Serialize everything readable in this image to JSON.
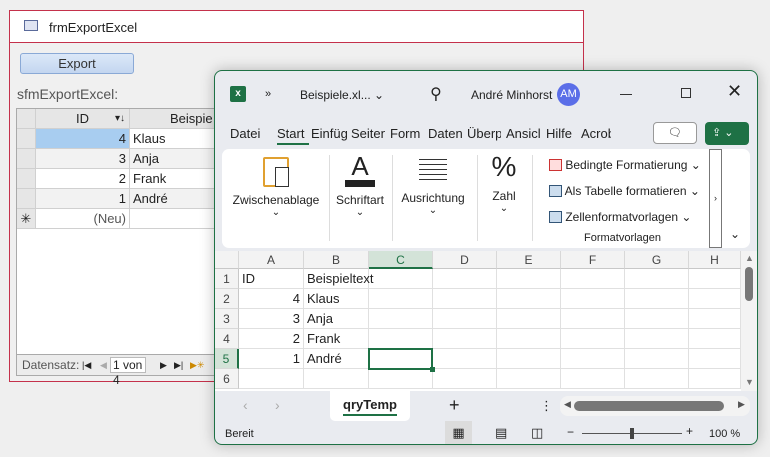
{
  "access": {
    "title": "frmExportExcel",
    "export_label": "Export",
    "subform_label": "sfmExportExcel:",
    "columns": [
      "ID",
      "Beispie"
    ],
    "rows": [
      {
        "id": "4",
        "text": "Klaus"
      },
      {
        "id": "3",
        "text": "Anja"
      },
      {
        "id": "2",
        "text": "Frank"
      },
      {
        "id": "1",
        "text": "André"
      }
    ],
    "new_row": "(Neu)",
    "nav_label": "Datensatz:",
    "nav_position": "1 von 4"
  },
  "excel": {
    "filename": "Beispiele.xl...",
    "user": "André Minhorst",
    "avatar": "AM",
    "accent": "#1e7145",
    "tabs": [
      "Datei",
      "Start",
      "Einfüg",
      "Seiten",
      "Form",
      "Daten",
      "Überp",
      "Ansicl",
      "Hilfe",
      "Acrob"
    ],
    "active_tab": "Start",
    "ribbon": {
      "clipboard": "Zwischenablage",
      "font": "Schriftart",
      "alignment": "Ausrichtung",
      "number": "Zahl",
      "styles": [
        "Bedingte Formatierung",
        "Als Tabelle formatieren",
        "Zellenformatvorlagen"
      ],
      "styles_group": "Formatvorlagen"
    },
    "columns": [
      "A",
      "B",
      "C",
      "D",
      "E",
      "F",
      "G",
      "H"
    ],
    "row_numbers": [
      "1",
      "2",
      "3",
      "4",
      "5",
      "6"
    ],
    "cells": [
      [
        "ID",
        "Beispieltext"
      ],
      [
        "4",
        "Klaus"
      ],
      [
        "3",
        "Anja"
      ],
      [
        "2",
        "Frank"
      ],
      [
        "1",
        "André"
      ]
    ],
    "active_cell": "C5",
    "sheet_tab": "qryTemp",
    "status": "Bereit",
    "zoom": "100 %",
    "zoom_value": 100
  }
}
